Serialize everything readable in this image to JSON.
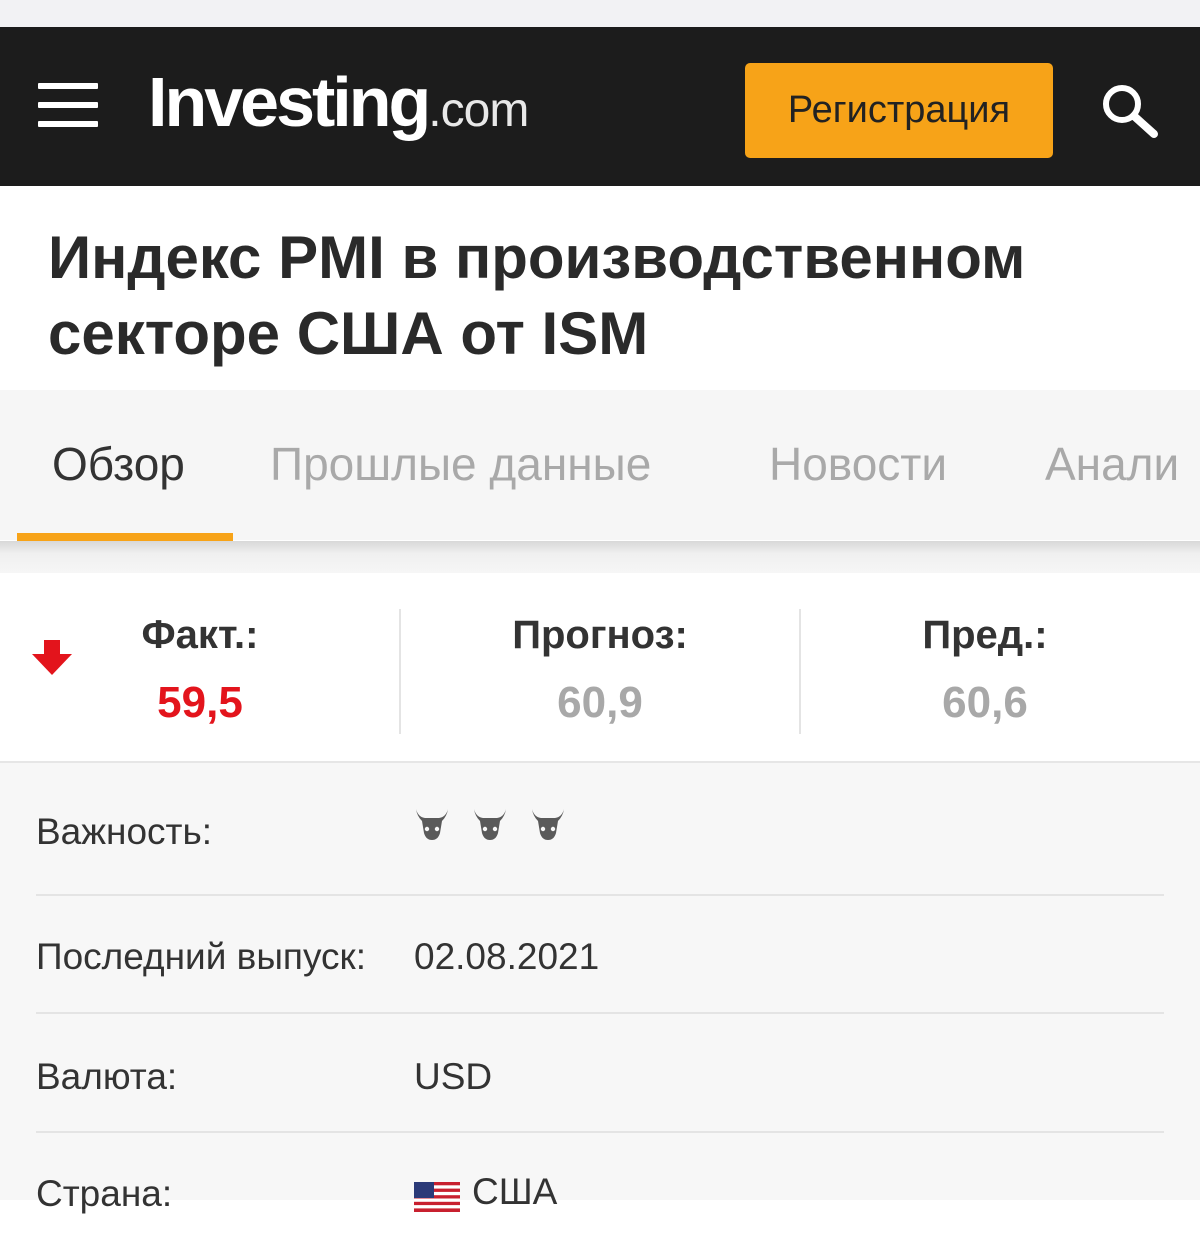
{
  "header": {
    "logo_main": "Investing",
    "logo_tld": ".com",
    "register_label": "Регистрация",
    "menu_icon": "hamburger-menu-icon",
    "search_icon": "search-icon"
  },
  "page": {
    "title": "Индекс PMI в производственном секторе США от ISM"
  },
  "tabs": [
    {
      "label": "Обзор",
      "active": true
    },
    {
      "label": "Прошлые данные",
      "active": false
    },
    {
      "label": "Новости",
      "active": false
    },
    {
      "label": "Анали",
      "active": false
    }
  ],
  "values": {
    "actual_label": "Факт.:",
    "actual_value": "59,5",
    "forecast_label": "Прогноз:",
    "forecast_value": "60,9",
    "previous_label": "Пред.:",
    "previous_value": "60,6",
    "trend_icon": "down-arrow-icon",
    "actual_color": "#e3141c"
  },
  "details": {
    "importance_label": "Важность:",
    "importance_level": 3,
    "importance_icon": "bull-icon",
    "last_release_label": "Последний выпуск:",
    "last_release_value": "02.08.2021",
    "currency_label": "Валюта:",
    "currency_value": "USD",
    "country_label": "Страна:",
    "country_value": "США",
    "country_flag_icon": "us-flag-icon"
  },
  "colors": {
    "header_bg": "#1c1c1c",
    "accent": "#f7a318",
    "negative": "#e3141c"
  }
}
